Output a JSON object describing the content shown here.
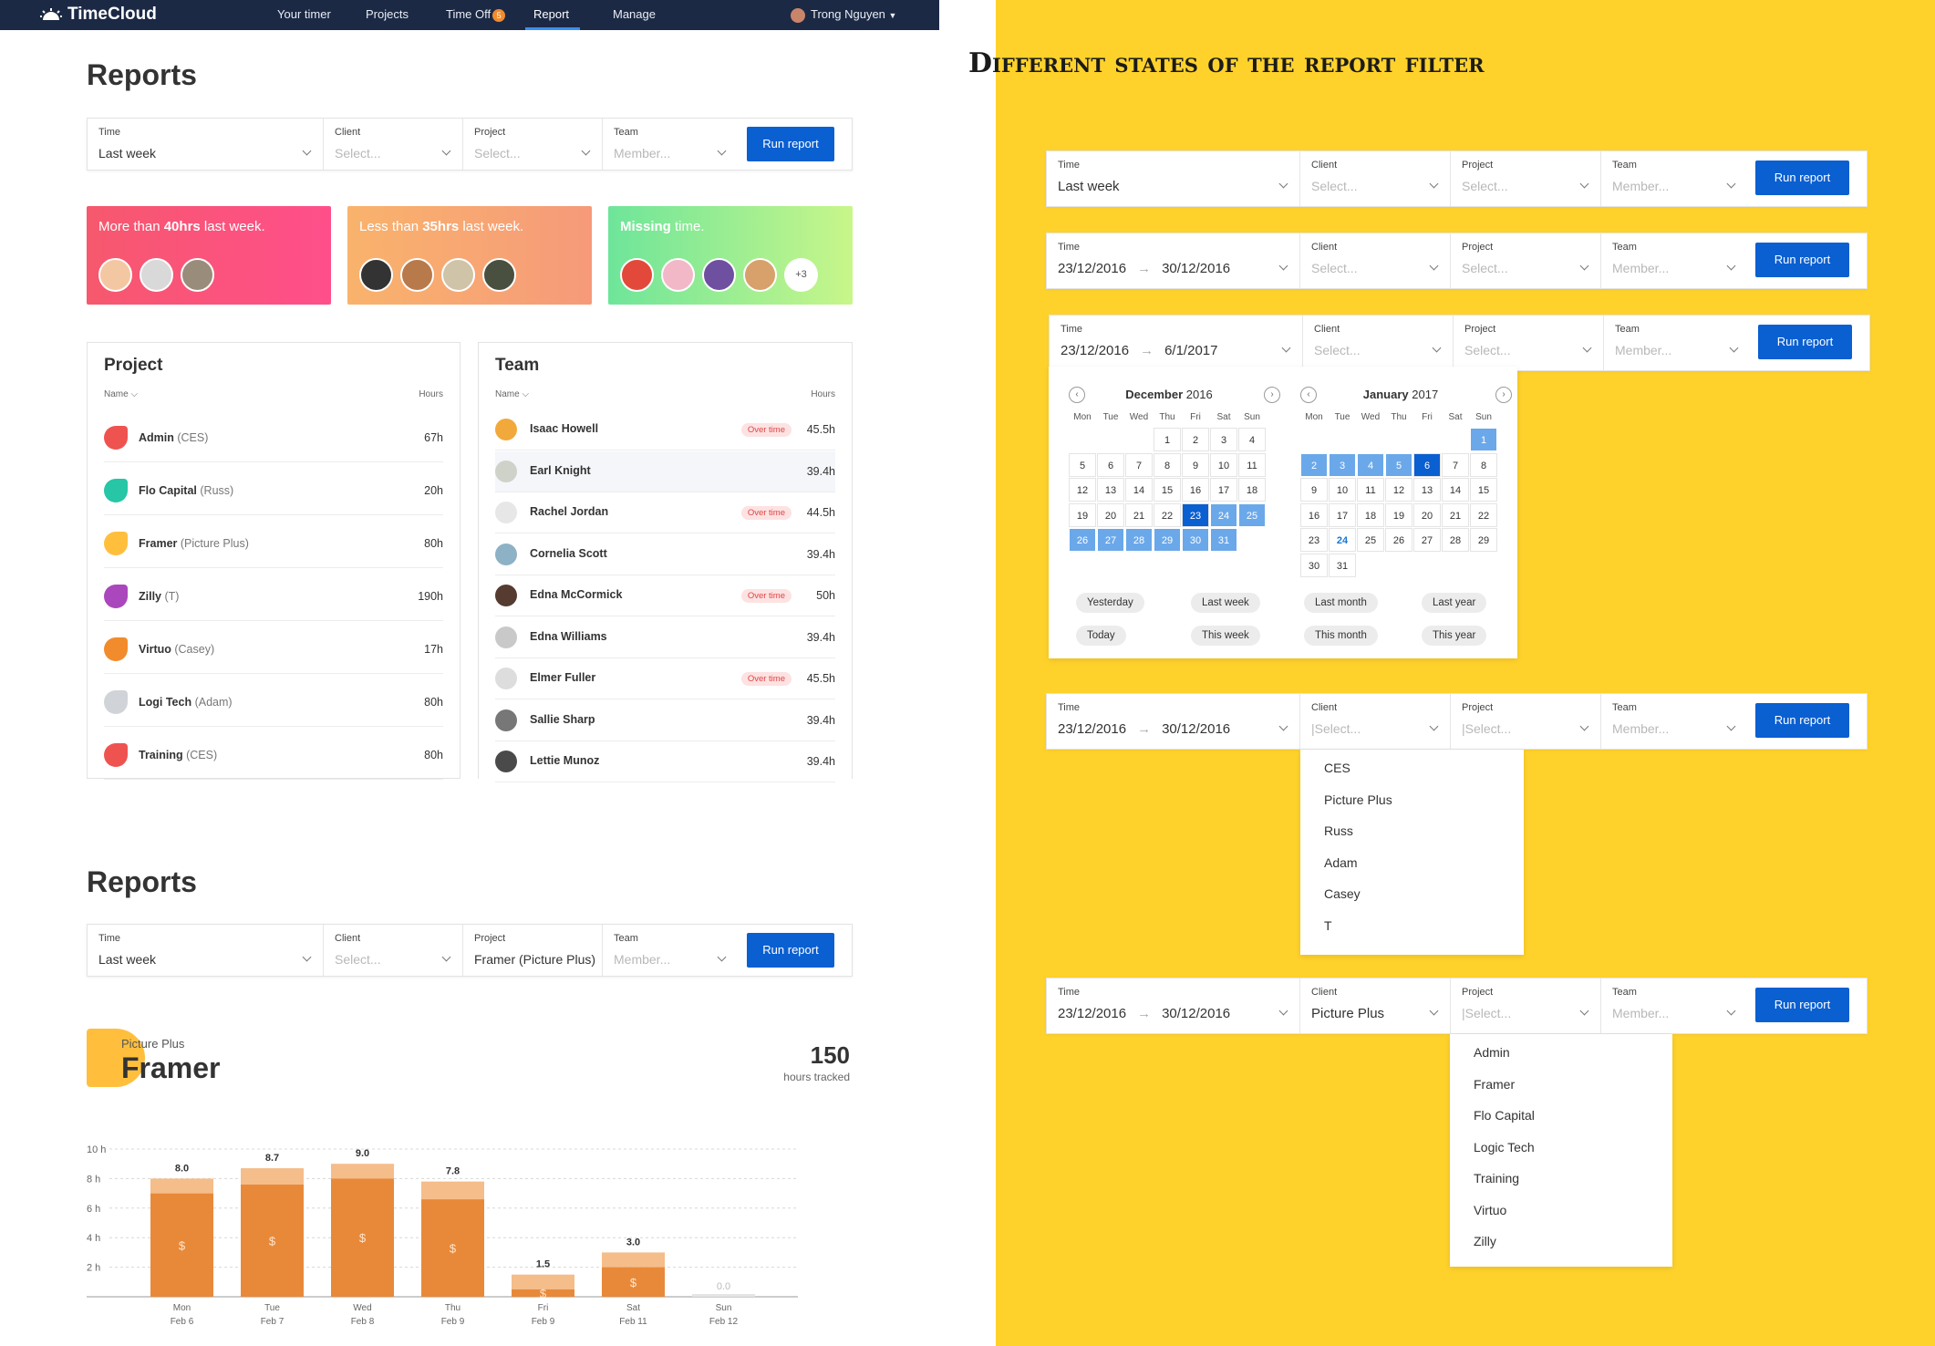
{
  "nav": {
    "logo": "TimeCloud",
    "links": [
      "Your timer",
      "Projects",
      "Time Off",
      "Report",
      "Manage"
    ],
    "timeoff_badge": "5",
    "user": "Trong Nguyen"
  },
  "reports_title": "Reports",
  "filter_labels": {
    "time": "Time",
    "client": "Client",
    "project": "Project",
    "team": "Team"
  },
  "filter_ph": {
    "client": "Select...",
    "project": "Select...",
    "team": "Member...",
    "client_cursor": "|Select...",
    "project_cursor": "|Select..."
  },
  "run_report": "Run report",
  "filter_values": {
    "last_week": "Last week",
    "from": "23/12/2016",
    "to1": "30/12/2016",
    "to2": "6/1/2017",
    "project_framer": "Framer (Picture Plus)",
    "client_pp": "Picture Plus"
  },
  "cards": [
    {
      "pre": "More than ",
      "bold": "40hrs",
      "post": " last week."
    },
    {
      "pre": "Less than ",
      "bold": "35hrs",
      "post": " last week."
    },
    {
      "pre": "",
      "bold": "Missing",
      "post": " time."
    }
  ],
  "cards_more": "+3",
  "project_panel": {
    "title": "Project",
    "col_name": "Name",
    "col_hours": "Hours",
    "rows": [
      {
        "name": "Admin",
        "client": "(CES)",
        "hours": "67h",
        "color": "#ef5350"
      },
      {
        "name": "Flo Capital",
        "client": "(Russ)",
        "hours": "20h",
        "color": "#26c6a6"
      },
      {
        "name": "Framer",
        "client": "(Picture Plus)",
        "hours": "80h",
        "color": "#ffbf3d"
      },
      {
        "name": "Zilly",
        "client": "(T)",
        "hours": "190h",
        "color": "#ab47bc"
      },
      {
        "name": "Virtuo",
        "client": "(Casey)",
        "hours": "17h",
        "color": "#f28b2c"
      },
      {
        "name": "Logi Tech",
        "client": "(Adam)",
        "hours": "80h",
        "color": "#d0d3d8"
      },
      {
        "name": "Training",
        "client": "(CES)",
        "hours": "80h",
        "color": "#ef5350"
      }
    ]
  },
  "team_panel": {
    "title": "Team",
    "col_name": "Name",
    "col_hours": "Hours",
    "ot_label": "Over time",
    "rows": [
      {
        "name": "Isaac Howell",
        "hours": "45.5h",
        "ot": true
      },
      {
        "name": "Earl Knight",
        "hours": "39.4h",
        "ot": false
      },
      {
        "name": "Rachel Jordan",
        "hours": "44.5h",
        "ot": true
      },
      {
        "name": "Cornelia Scott",
        "hours": "39.4h",
        "ot": false
      },
      {
        "name": "Edna McCormick",
        "hours": "50h",
        "ot": true
      },
      {
        "name": "Edna Williams",
        "hours": "39.4h",
        "ot": false
      },
      {
        "name": "Elmer Fuller",
        "hours": "45.5h",
        "ot": true
      },
      {
        "name": "Sallie Sharp",
        "hours": "39.4h",
        "ot": false
      },
      {
        "name": "Lettie Munoz",
        "hours": "39.4h",
        "ot": false
      }
    ]
  },
  "framer": {
    "client": "Picture Plus",
    "name": "Framer",
    "total": "150",
    "total_label": "hours tracked"
  },
  "chart_data": {
    "type": "bar",
    "categories": [
      "Mon Feb 6",
      "Tue Feb 7",
      "Wed Feb 8",
      "Thu Feb 9",
      "Fri Feb 9",
      "Sat Feb 11",
      "Sun Feb 12"
    ],
    "day": [
      "Mon",
      "Tue",
      "Wed",
      "Thu",
      "Fri",
      "Sat",
      "Sun"
    ],
    "date": [
      "Feb 6",
      "Feb 7",
      "Feb 8",
      "Feb 9",
      "Feb 9",
      "Feb 11",
      "Feb 12"
    ],
    "series": [
      {
        "values": [
          7.0,
          7.6,
          8.0,
          6.6,
          0.5,
          2.0,
          0
        ]
      },
      {
        "values": [
          1.0,
          1.1,
          1.0,
          1.2,
          1.0,
          1.0,
          0
        ]
      }
    ],
    "totals": [
      "8.0",
      "8.7",
      "9.0",
      "7.8",
      "1.5",
      "3.0",
      "0.0"
    ],
    "yticks": [
      "2 h",
      "4 h",
      "6 h",
      "8 h",
      "10 h"
    ],
    "ylim": [
      0,
      10
    ],
    "billable_symbol": "$",
    "colors": {
      "billable": "#e8893a",
      "nonbillable": "#f5bd8a"
    }
  },
  "right_title": "Different states of the report filter",
  "calendar": {
    "dec_month": "December",
    "dec_year": "2016",
    "jan_month": "January",
    "jan_year": "2017",
    "weekdays": [
      "Mon",
      "Tue",
      "Wed",
      "Thu",
      "Fri",
      "Sat",
      "Sun"
    ],
    "quick": [
      "Yesterday",
      "Last week",
      "Last month",
      "Last year",
      "Today",
      "This week",
      "This month",
      "This year"
    ]
  },
  "client_options": [
    "CES",
    "Picture Plus",
    "Russ",
    "Adam",
    "Casey",
    "T"
  ],
  "project_options": [
    "Admin",
    "Framer",
    "Flo Capital",
    "Logic Tech",
    "Training",
    "Virtuo",
    "Zilly"
  ]
}
